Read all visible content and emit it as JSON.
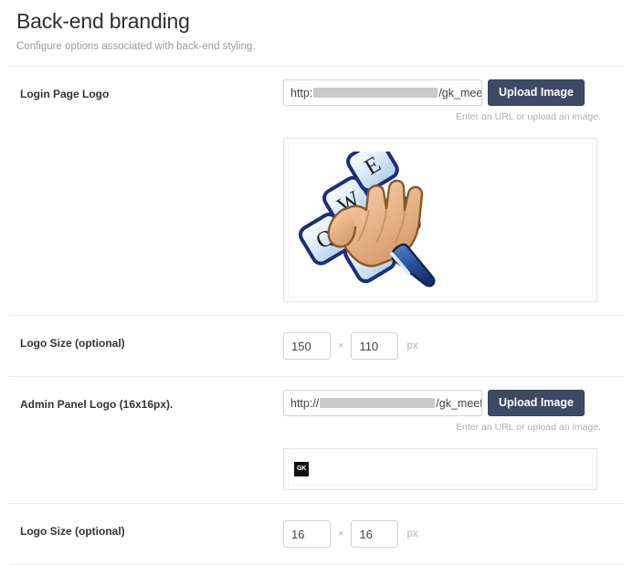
{
  "header": {
    "title": "Back-end branding",
    "subtitle": "Configure options associated with back-end styling."
  },
  "login_logo": {
    "label": "Login Page Logo",
    "url_scheme": "http:",
    "url_tail": "/gk_meetg",
    "url_placeholder": "Enter an URL",
    "upload_label": "Upload Image",
    "helper": "Enter an URL or upload an image.",
    "preview_alt": "qwe-keyboard-hand-logo"
  },
  "login_logo_size": {
    "label": "Logo Size (optional)",
    "width": "150",
    "height": "110",
    "separator": "×",
    "unit": "px"
  },
  "admin_logo": {
    "label": "Admin Panel Logo (16x16px).",
    "url_scheme": "http://",
    "url_tail": "/gk_meetg",
    "url_placeholder": "Enter an URL",
    "upload_label": "Upload Image",
    "helper": "Enter an URL or upload an image.",
    "preview_alt": "gk-favicon",
    "favicon_text": "GK"
  },
  "admin_logo_size": {
    "label": "Logo Size (optional)",
    "width": "16",
    "height": "16",
    "separator": "×",
    "unit": "px"
  },
  "colors": {
    "button_bg": "#3c4a66",
    "button_text": "#ffffff",
    "label_text": "#333333",
    "helper_text": "#b0b0b0",
    "border": "#d2d2d2",
    "divider": "#e8e8e8",
    "favicon_bg": "#111111"
  }
}
